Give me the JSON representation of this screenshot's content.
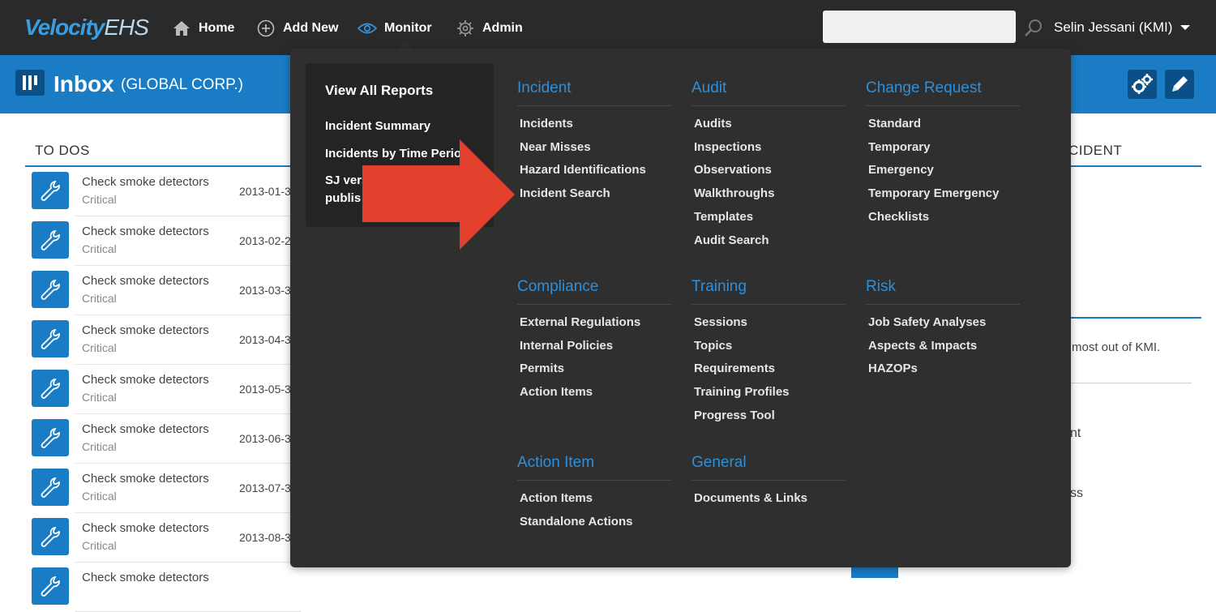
{
  "brand": {
    "logo_main": "Velocity",
    "logo_suffix": "EHS"
  },
  "topnav": {
    "home": "Home",
    "add_new": "Add New",
    "monitor": "Monitor",
    "admin": "Admin",
    "search_placeholder": "",
    "user": "Selin Jessani (KMI)"
  },
  "header": {
    "title": "Inbox",
    "subtitle": "(GLOBAL CORP.)"
  },
  "todos": {
    "heading": "TO DOS",
    "items": [
      {
        "title": "Check smoke detectors",
        "priority": "Critical",
        "date": "2013-01-3"
      },
      {
        "title": "Check smoke detectors",
        "priority": "Critical",
        "date": "2013-02-2"
      },
      {
        "title": "Check smoke detectors",
        "priority": "Critical",
        "date": "2013-03-3"
      },
      {
        "title": "Check smoke detectors",
        "priority": "Critical",
        "date": "2013-04-3"
      },
      {
        "title": "Check smoke detectors",
        "priority": "Critical",
        "date": "2013-05-3"
      },
      {
        "title": "Check smoke detectors",
        "priority": "Critical",
        "date": "2013-06-3"
      },
      {
        "title": "Check smoke detectors",
        "priority": "Critical",
        "date": "2013-07-3"
      },
      {
        "title": "Check smoke detectors",
        "priority": "Critical",
        "date": "2013-08-3"
      },
      {
        "title": "Check smoke detectors",
        "priority": "",
        "date": ""
      }
    ]
  },
  "right_panel": {
    "heading": "CIDENT",
    "text": "most out of KMI.",
    "t2": "nt",
    "t3": "ss"
  },
  "monitor_menu": {
    "reports": {
      "title": "View All Reports",
      "links": [
        "Incident Summary",
        "Incidents by Time Period",
        "SJ vers",
        "publis"
      ]
    },
    "incident": {
      "heading": "Incident",
      "links": [
        "Incidents",
        "Near Misses",
        "Hazard Identifications",
        "Incident Search"
      ]
    },
    "audit": {
      "heading": "Audit",
      "links": [
        "Audits",
        "Inspections",
        "Observations",
        "Walkthroughs",
        "Templates",
        "Audit Search"
      ]
    },
    "change_request": {
      "heading": "Change Request",
      "links": [
        "Standard",
        "Temporary",
        "Emergency",
        "Temporary Emergency",
        "Checklists"
      ]
    },
    "compliance": {
      "heading": "Compliance",
      "links": [
        "External Regulations",
        "Internal Policies",
        "Permits",
        "Action Items"
      ]
    },
    "training": {
      "heading": "Training",
      "links": [
        "Sessions",
        "Topics",
        "Requirements",
        "Training Profiles",
        "Progress Tool"
      ]
    },
    "risk": {
      "heading": "Risk",
      "links": [
        "Job Safety Analyses",
        "Aspects & Impacts",
        "HAZOPs"
      ]
    },
    "action_item": {
      "heading": "Action Item",
      "links": [
        "Action Items",
        "Standalone Actions"
      ]
    },
    "general": {
      "heading": "General",
      "links": [
        "Documents & Links"
      ]
    }
  },
  "colors": {
    "nav_bg": "#2a2a2a",
    "brand_blue": "#1a7cc4",
    "menu_bg": "#2f2f2f",
    "menu_heading": "#2e8fda",
    "arrow": "#e2402d"
  },
  "icons": [
    "home-icon",
    "add-icon",
    "eye-icon",
    "gear-icon",
    "search-icon",
    "caret-down-icon",
    "inbox-icon",
    "settings-gears-icon",
    "pencil-icon",
    "wrench-icon",
    "arrow-pointer"
  ]
}
